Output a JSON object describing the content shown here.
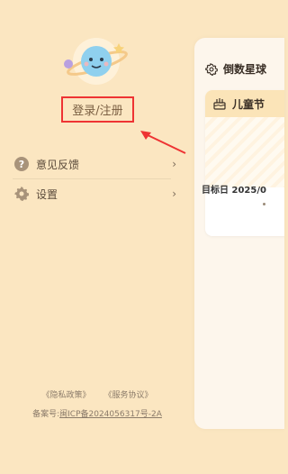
{
  "drawer": {
    "login_label": "登录/注册",
    "menu": [
      {
        "label": "意见反馈",
        "icon": "help-icon"
      },
      {
        "label": "设置",
        "icon": "gear-icon"
      }
    ],
    "privacy_link": "《隐私政策》",
    "service_link": "《服务协议》",
    "icp_prefix": "备案号:",
    "icp_number": "闽ICP备2024056317号-2A"
  },
  "preview": {
    "header_title": "倒数星球",
    "card_title": "儿童节",
    "card_target": "目标日 2025/0"
  },
  "colors": {
    "background": "#fbe6c1",
    "highlight_border": "#ee3333",
    "arrow": "#e33333"
  }
}
